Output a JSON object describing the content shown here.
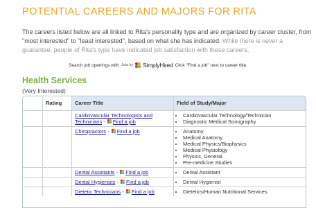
{
  "page_title": "POTENTIAL CAREERS AND MAJORS FOR RITA",
  "intro": {
    "main": "The careers listed below are all linked to Rita's personality type and are organized by career cluster, from \"most interested\" to \"least interested\", based on what she has indicated.",
    "faded": "While there is never a guarantee, people of Rita's type have indicated job satisfaction with these careers."
  },
  "search_bar": {
    "prefix": "Search job openings with",
    "logo_jobs": "Jobs by",
    "logo_text": "SimplyHired",
    "suffix": "Click \"Find a job\" next to career title."
  },
  "section": {
    "title": "Health Services",
    "subtitle": "(Very Interested)"
  },
  "table": {
    "headers": {
      "blank": "",
      "rating": "Rating",
      "career": "Career Title",
      "field": "Field of Study/Major"
    },
    "find_job_label": "Find a job",
    "rows": [
      {
        "career": "Cardiovascular Technologists and Technicians",
        "fields": [
          "Cardiovascular Technology/Technician",
          "Diagnostic Medical Sonography"
        ]
      },
      {
        "career": "Chiropractors",
        "fields": [
          "Anatomy",
          "Medical Anatomy",
          "Medical Physics/Biophysics",
          "Medical Physiology",
          "Physics, General",
          "Pre-medicine Studies"
        ]
      },
      {
        "career": "Dental Assistants",
        "fields": [
          "Dental Assistant"
        ]
      },
      {
        "career": "Dental Hygienists",
        "fields": [
          "Dental Hygienist"
        ]
      },
      {
        "career": "Dietetic Technicians",
        "fields": [
          "Dietetics/Human Nutritional Services"
        ]
      }
    ]
  },
  "colors": {
    "title": "#f2a21c",
    "section_title": "#7ab040",
    "link": "#1a1aa8",
    "header_bg": "#dce7f1"
  }
}
